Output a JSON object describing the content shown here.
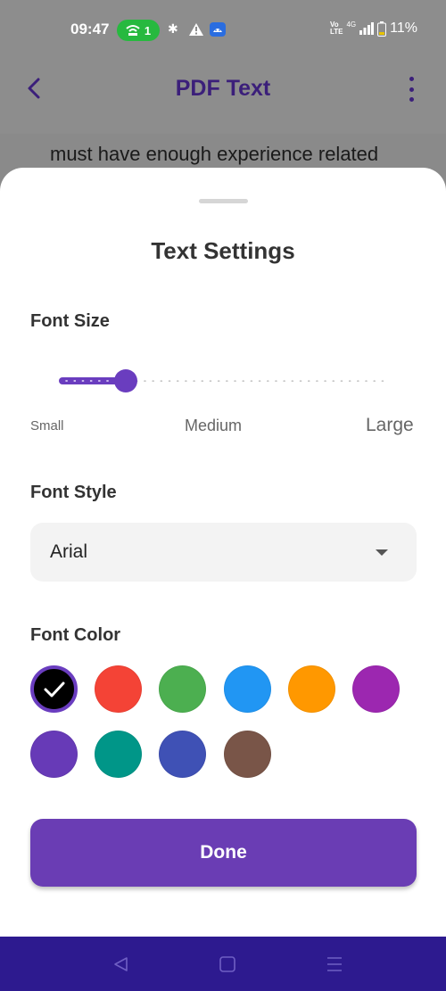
{
  "status_bar": {
    "time": "09:47",
    "hotspot_count": "1",
    "battery": "11%",
    "network": "4G",
    "volte_line1": "Vo",
    "volte_line2": "LTE",
    "icons": [
      "wifi-hotspot-icon",
      "slack-icon",
      "warning-icon",
      "android-icon",
      "volte-icon",
      "signal-icon",
      "battery-icon"
    ]
  },
  "app_bar": {
    "title": "PDF Text",
    "back_icon": "chevron-left-icon",
    "menu_icon": "more-vert-icon"
  },
  "document": {
    "visible_line": "must have enough experience related"
  },
  "sheet": {
    "title": "Text Settings",
    "font_size": {
      "label": "Font Size",
      "min_label": "Small",
      "mid_label": "Medium",
      "max_label": "Large",
      "value_fraction": 0.205
    },
    "font_style": {
      "label": "Font Style",
      "selected": "Arial"
    },
    "font_color": {
      "label": "Font Color",
      "swatches": [
        {
          "color": "#000000",
          "selected": true
        },
        {
          "color": "#f44336",
          "selected": false
        },
        {
          "color": "#4caf50",
          "selected": false
        },
        {
          "color": "#2196f3",
          "selected": false
        },
        {
          "color": "#ff9800",
          "selected": false
        },
        {
          "color": "#9c27b0",
          "selected": false
        },
        {
          "color": "#673ab7",
          "selected": false
        },
        {
          "color": "#009688",
          "selected": false
        },
        {
          "color": "#3f51b5",
          "selected": false
        },
        {
          "color": "#795548",
          "selected": false
        }
      ]
    },
    "done_label": "Done"
  },
  "colors": {
    "accent": "#6a3dbf",
    "app_title": "#3b1f7a",
    "nav_bar": "#2d1a8f"
  },
  "nav_bar": {
    "icons": [
      "back-triangle-icon",
      "home-square-icon",
      "recents-menu-icon"
    ]
  }
}
